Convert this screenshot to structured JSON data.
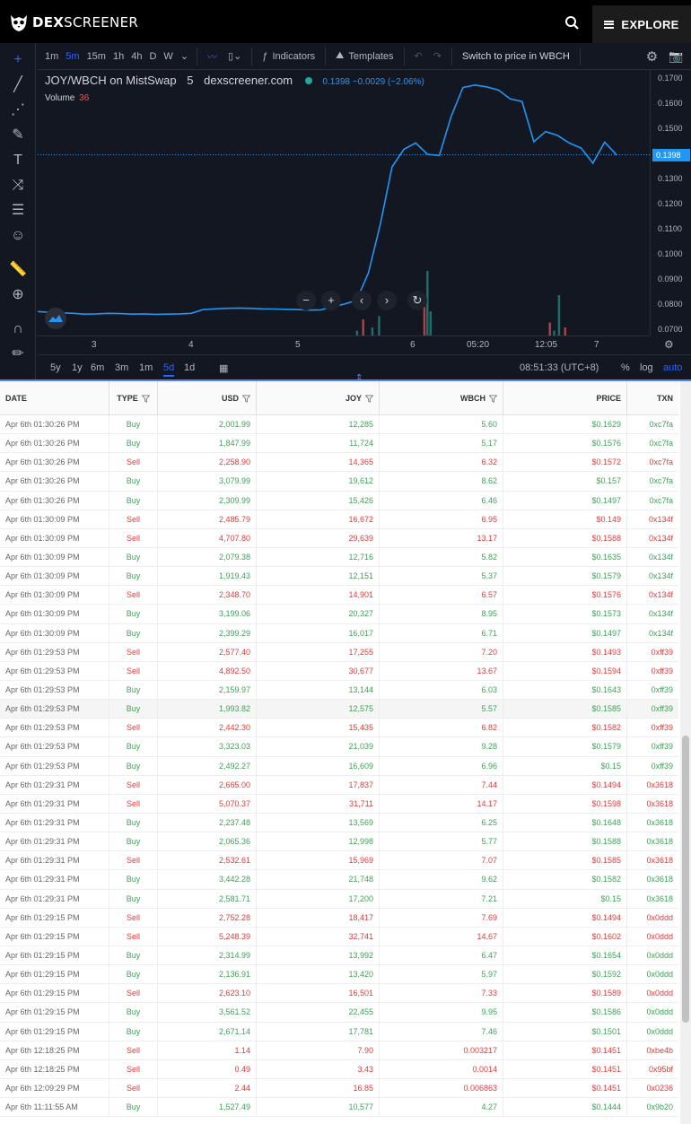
{
  "header": {
    "brand_bold": "DEX",
    "brand_light": "SCREENER",
    "explore_label": "EXPLORE"
  },
  "toolbar": {
    "timeframes": [
      "1m",
      "5m",
      "15m",
      "1h",
      "4h",
      "D",
      "W"
    ],
    "active_timeframe": "5m",
    "indicators_label": "Indicators",
    "templates_label": "Templates",
    "switch_label": "Switch to price in WBCH"
  },
  "legend": {
    "pair": "JOY/WBCH on MistSwap",
    "interval": "5",
    "source": "dexscreener.com",
    "price": "0.1398",
    "change": "−0.0029 (−2.06%)",
    "volume_label": "Volume",
    "volume_value": "36"
  },
  "chart_data": {
    "type": "line",
    "price_axis_labels": [
      "0.1700",
      "0.1600",
      "0.1500",
      "0.1400",
      "0.1300",
      "0.1200",
      "0.1100",
      "0.1000",
      "0.0900",
      "0.0800",
      "0.0700"
    ],
    "current_price_label": "0.1398",
    "time_axis_labels": [
      "3",
      "4",
      "5",
      "6",
      "05:20",
      "12:05",
      "7"
    ],
    "ylim": [
      0.068,
      0.1735
    ],
    "series": [
      {
        "values": [
          0.0775,
          0.0772,
          0.077,
          0.0768,
          0.0765,
          0.0766,
          0.0768,
          0.0767,
          0.0765,
          0.0766,
          0.0764,
          0.0765,
          0.0766,
          0.0768,
          0.0783,
          0.0786,
          0.0788,
          0.0789,
          0.0788,
          0.0786,
          0.0785,
          0.0784,
          0.0783,
          0.0781,
          0.0782,
          0.0795,
          0.0805,
          0.082,
          0.093,
          0.112,
          0.135,
          0.142,
          0.1445,
          0.14,
          0.1395,
          0.155,
          0.1665,
          0.1675,
          0.1668,
          0.1655,
          0.162,
          0.161,
          0.145,
          0.149,
          0.1475,
          0.1445,
          0.1425,
          0.1365,
          0.1448,
          0.1398
        ]
      }
    ],
    "volume": [
      {
        "x": 0.52,
        "v": 3
      },
      {
        "x": 0.53,
        "v": 10
      },
      {
        "x": 0.545,
        "v": 5
      },
      {
        "x": 0.556,
        "v": 12
      },
      {
        "x": 0.63,
        "v": 20
      },
      {
        "x": 0.635,
        "v": 40
      },
      {
        "x": 0.64,
        "v": 15
      },
      {
        "x": 0.835,
        "v": 8
      },
      {
        "x": 0.842,
        "v": 3
      },
      {
        "x": 0.85,
        "v": 25
      },
      {
        "x": 0.86,
        "v": 5
      }
    ]
  },
  "range_bar": {
    "ranges": [
      "5y",
      "1y",
      "6m",
      "3m",
      "1m",
      "5d",
      "1d"
    ],
    "active": "5d",
    "clock": "08:51:33 (UTC+8)",
    "pct": "%",
    "log": "log",
    "auto": "auto"
  },
  "table": {
    "headers": [
      "DATE",
      "TYPE",
      "USD",
      "JOY",
      "WBCH",
      "PRICE",
      "TXN"
    ],
    "rows": [
      [
        "Apr 6th 01:30:26 PM",
        "Buy",
        "2,001.99",
        "12,285",
        "5.60",
        "$0.1629",
        "0xc7fa"
      ],
      [
        "Apr 6th 01:30:26 PM",
        "Buy",
        "1,847.99",
        "11,724",
        "5.17",
        "$0.1576",
        "0xc7fa"
      ],
      [
        "Apr 6th 01:30:26 PM",
        "Sell",
        "2,258.90",
        "14,365",
        "6.32",
        "$0.1572",
        "0xc7fa"
      ],
      [
        "Apr 6th 01:30:26 PM",
        "Buy",
        "3,079.99",
        "19,612",
        "8.62",
        "$0.157",
        "0xc7fa"
      ],
      [
        "Apr 6th 01:30:26 PM",
        "Buy",
        "2,309.99",
        "15,426",
        "6.46",
        "$0.1497",
        "0xc7fa"
      ],
      [
        "Apr 6th 01:30:09 PM",
        "Sell",
        "2,485.79",
        "16,672",
        "6.95",
        "$0.149",
        "0x134f"
      ],
      [
        "Apr 6th 01:30:09 PM",
        "Sell",
        "4,707.80",
        "29,639",
        "13.17",
        "$0.1588",
        "0x134f"
      ],
      [
        "Apr 6th 01:30:09 PM",
        "Buy",
        "2,079.38",
        "12,716",
        "5.82",
        "$0.1635",
        "0x134f"
      ],
      [
        "Apr 6th 01:30:09 PM",
        "Buy",
        "1,919.43",
        "12,151",
        "5.37",
        "$0.1579",
        "0x134f"
      ],
      [
        "Apr 6th 01:30:09 PM",
        "Sell",
        "2,348.70",
        "14,901",
        "6.57",
        "$0.1576",
        "0x134f"
      ],
      [
        "Apr 6th 01:30:09 PM",
        "Buy",
        "3,199.06",
        "20,327",
        "8.95",
        "$0.1573",
        "0x134f"
      ],
      [
        "Apr 6th 01:30:09 PM",
        "Buy",
        "2,399.29",
        "16,017",
        "6.71",
        "$0.1497",
        "0x134f"
      ],
      [
        "Apr 6th 01:29:53 PM",
        "Sell",
        "2,577.40",
        "17,255",
        "7.20",
        "$0.1493",
        "0xff39"
      ],
      [
        "Apr 6th 01:29:53 PM",
        "Sell",
        "4,892.50",
        "30,677",
        "13.67",
        "$0.1594",
        "0xff39"
      ],
      [
        "Apr 6th 01:29:53 PM",
        "Buy",
        "2,159.97",
        "13,144",
        "6.03",
        "$0.1643",
        "0xff39"
      ],
      [
        "Apr 6th 01:29:53 PM",
        "Buy",
        "1,993.82",
        "12,575",
        "5.57",
        "$0.1585",
        "0xff39"
      ],
      [
        "Apr 6th 01:29:53 PM",
        "Sell",
        "2,442.30",
        "15,435",
        "6.82",
        "$0.1582",
        "0xff39"
      ],
      [
        "Apr 6th 01:29:53 PM",
        "Buy",
        "3,323.03",
        "21,039",
        "9.28",
        "$0.1579",
        "0xff39"
      ],
      [
        "Apr 6th 01:29:53 PM",
        "Buy",
        "2,492.27",
        "16,609",
        "6.96",
        "$0.15",
        "0xff39"
      ],
      [
        "Apr 6th 01:29:31 PM",
        "Sell",
        "2,665.00",
        "17,837",
        "7.44",
        "$0.1494",
        "0x3618"
      ],
      [
        "Apr 6th 01:29:31 PM",
        "Sell",
        "5,070.37",
        "31,711",
        "14.17",
        "$0.1598",
        "0x3618"
      ],
      [
        "Apr 6th 01:29:31 PM",
        "Buy",
        "2,237.48",
        "13,569",
        "6.25",
        "$0.1648",
        "0x3618"
      ],
      [
        "Apr 6th 01:29:31 PM",
        "Buy",
        "2,065.36",
        "12,998",
        "5.77",
        "$0.1588",
        "0x3618"
      ],
      [
        "Apr 6th 01:29:31 PM",
        "Sell",
        "2,532.61",
        "15,969",
        "7.07",
        "$0.1585",
        "0x3618"
      ],
      [
        "Apr 6th 01:29:31 PM",
        "Buy",
        "3,442.28",
        "21,748",
        "9.62",
        "$0.1582",
        "0x3618"
      ],
      [
        "Apr 6th 01:29:31 PM",
        "Buy",
        "2,581.71",
        "17,200",
        "7.21",
        "$0.15",
        "0x3618"
      ],
      [
        "Apr 6th 01:29:15 PM",
        "Sell",
        "2,752.28",
        "18,417",
        "7.69",
        "$0.1494",
        "0x0ddd"
      ],
      [
        "Apr 6th 01:29:15 PM",
        "Sell",
        "5,248.39",
        "32,741",
        "14.67",
        "$0.1602",
        "0x0ddd"
      ],
      [
        "Apr 6th 01:29:15 PM",
        "Buy",
        "2,314.99",
        "13,992",
        "6.47",
        "$0.1654",
        "0x0ddd"
      ],
      [
        "Apr 6th 01:29:15 PM",
        "Buy",
        "2,136.91",
        "13,420",
        "5.97",
        "$0.1592",
        "0x0ddd"
      ],
      [
        "Apr 6th 01:29:15 PM",
        "Sell",
        "2,623.10",
        "16,501",
        "7.33",
        "$0.1589",
        "0x0ddd"
      ],
      [
        "Apr 6th 01:29:15 PM",
        "Buy",
        "3,561.52",
        "22,455",
        "9.95",
        "$0.1586",
        "0x0ddd"
      ],
      [
        "Apr 6th 01:29:15 PM",
        "Buy",
        "2,671.14",
        "17,781",
        "7.46",
        "$0.1501",
        "0x0ddd"
      ],
      [
        "Apr 6th 12:18:25 PM",
        "Sell",
        "1.14",
        "7.90",
        "0.003217",
        "$0.1451",
        "0xbe4b"
      ],
      [
        "Apr 6th 12:18:25 PM",
        "Sell",
        "0.49",
        "3.43",
        "0.0014",
        "$0.1451",
        "0x95bf"
      ],
      [
        "Apr 6th 12:09:29 PM",
        "Sell",
        "2.44",
        "16.85",
        "0.006863",
        "$0.1451",
        "0x0236"
      ],
      [
        "Apr 6th 11:11:55 AM",
        "Buy",
        "1,527.49",
        "10,577",
        "4.27",
        "$0.1444",
        "0x9b20"
      ]
    ]
  },
  "colors": {
    "buy": "#3fa157",
    "sell": "#e03c3c",
    "line": "#2196f3",
    "chart_bg": "#131722"
  }
}
